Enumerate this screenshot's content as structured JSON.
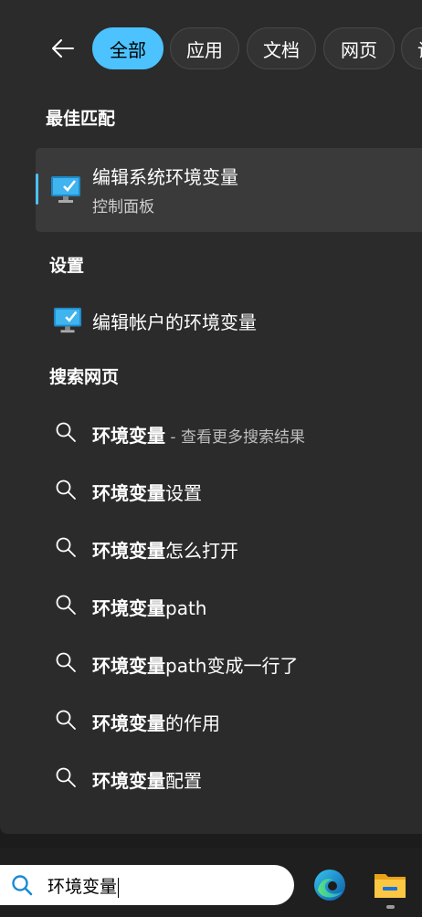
{
  "tabs": [
    {
      "label": "全部",
      "active": true
    },
    {
      "label": "应用",
      "active": false
    },
    {
      "label": "文档",
      "active": false
    },
    {
      "label": "网页",
      "active": false
    },
    {
      "label": "设",
      "active": false
    }
  ],
  "best_match": {
    "heading": "最佳匹配",
    "title": "编辑系统环境变量",
    "subtitle": "控制面板",
    "icon": "control-panel-monitor-icon"
  },
  "settings": {
    "heading": "设置",
    "items": [
      {
        "label": "编辑帐户的环境变量",
        "icon": "control-panel-monitor-icon"
      }
    ]
  },
  "web_search": {
    "heading": "搜索网页",
    "items": [
      {
        "bold": "环境变量",
        "rest": "",
        "hint": " - 查看更多搜索结果"
      },
      {
        "bold": "环境变量",
        "rest": "设置",
        "hint": ""
      },
      {
        "bold": "环境变量",
        "rest": "怎么打开",
        "hint": ""
      },
      {
        "bold": "环境变量",
        "rest": "path",
        "hint": ""
      },
      {
        "bold": "环境变量",
        "rest": "path变成一行了",
        "hint": ""
      },
      {
        "bold": "环境变量",
        "rest": "的作用",
        "hint": ""
      },
      {
        "bold": "环境变量",
        "rest": "配置",
        "hint": ""
      }
    ]
  },
  "taskbar": {
    "search_value": "环境变量",
    "apps": [
      "edge-icon",
      "file-explorer-icon"
    ]
  },
  "colors": {
    "accent": "#4cc2ff",
    "panel": "#2b2b2b",
    "selected": "#3a3a3a"
  }
}
